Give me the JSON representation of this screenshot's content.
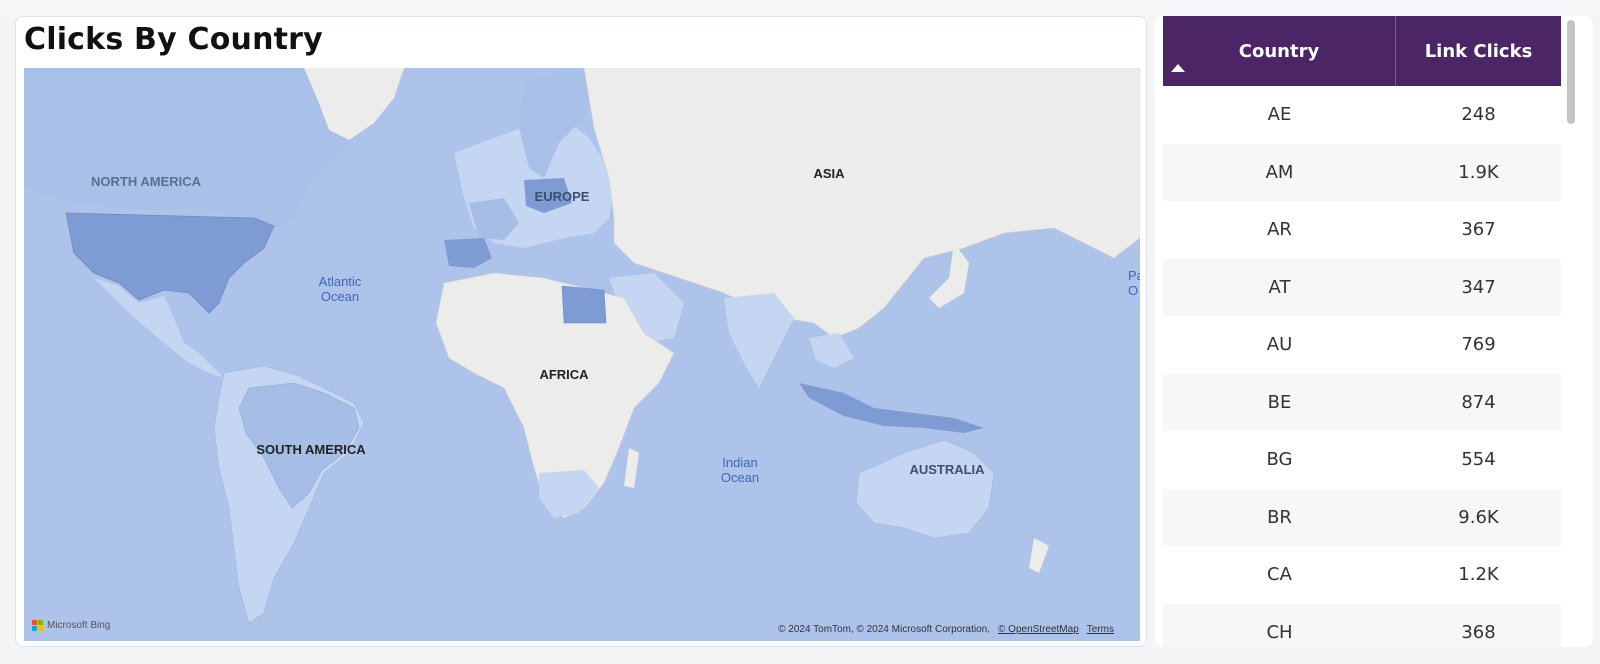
{
  "map": {
    "title": "Clicks By Country",
    "labels": {
      "north_america": "NORTH AMERICA",
      "europe": "EUROPE",
      "asia": "ASIA",
      "africa": "AFRICA",
      "south_america": "SOUTH AMERICA",
      "australia": "AUSTRALIA",
      "atlantic_1": "Atlantic",
      "atlantic_2": "Ocean",
      "indian_1": "Indian",
      "indian_2": "Ocean",
      "pacific_1": "Pa",
      "pacific_2": "O"
    },
    "provider": "Microsoft Bing",
    "attribution": "© 2024 TomTom, © 2024 Microsoft Corporation,",
    "osm_link": "© OpenStreetMap",
    "terms_link": "Terms",
    "colors": {
      "water": "#aec3ea",
      "land": "#ececea",
      "shade_light": "#c4d6f1",
      "shade_mid": "#a6bde6",
      "shade_dark": "#7f9bd3"
    }
  },
  "table": {
    "headers": {
      "country": "Country",
      "clicks": "Link Clicks"
    },
    "sort_icon": "sort-ascending-icon",
    "header_color": "#4b2566",
    "rows": [
      {
        "country": "AE",
        "clicks": "248"
      },
      {
        "country": "AM",
        "clicks": "1.9K"
      },
      {
        "country": "AR",
        "clicks": "367"
      },
      {
        "country": "AT",
        "clicks": "347"
      },
      {
        "country": "AU",
        "clicks": "769"
      },
      {
        "country": "BE",
        "clicks": "874"
      },
      {
        "country": "BG",
        "clicks": "554"
      },
      {
        "country": "BR",
        "clicks": "9.6K"
      },
      {
        "country": "CA",
        "clicks": "1.2K"
      },
      {
        "country": "CH",
        "clicks": "368"
      }
    ]
  }
}
